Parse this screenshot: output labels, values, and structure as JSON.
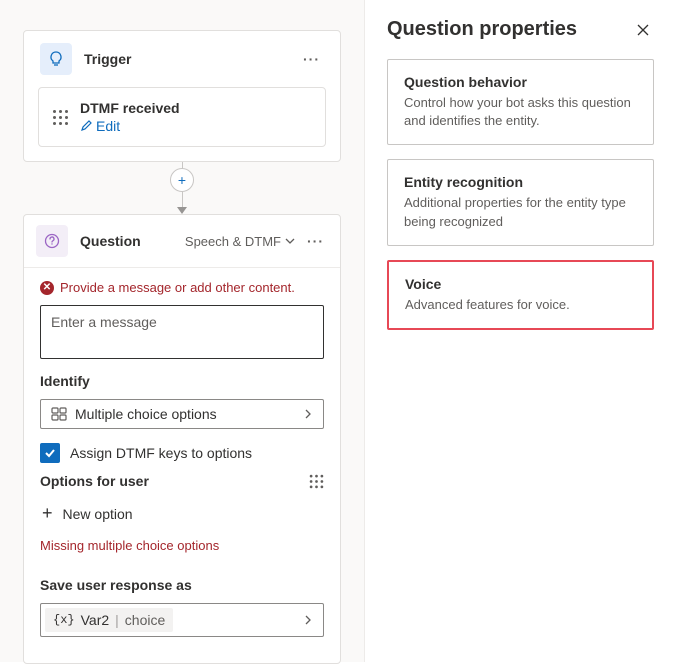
{
  "trigger": {
    "title": "Trigger",
    "node": {
      "name": "DTMF received",
      "edit_label": "Edit"
    }
  },
  "question": {
    "title": "Question",
    "mode_label": "Speech & DTMF",
    "error_message": "Provide a message or add other content.",
    "message_placeholder": "Enter a message",
    "identify_label": "Identify",
    "identify_value": "Multiple choice options",
    "assign_dtmf_label": "Assign DTMF keys to options",
    "options_label": "Options for user",
    "new_option_label": "New option",
    "missing_options_error": "Missing multiple choice options",
    "save_response_label": "Save user response as",
    "variable": {
      "name": "Var2",
      "type": "choice"
    }
  },
  "panel": {
    "title": "Question properties",
    "cards": [
      {
        "title": "Question behavior",
        "desc": "Control how your bot asks this question and identifies the entity."
      },
      {
        "title": "Entity recognition",
        "desc": "Additional properties for the entity type being recognized"
      },
      {
        "title": "Voice",
        "desc": "Advanced features for voice."
      }
    ]
  }
}
